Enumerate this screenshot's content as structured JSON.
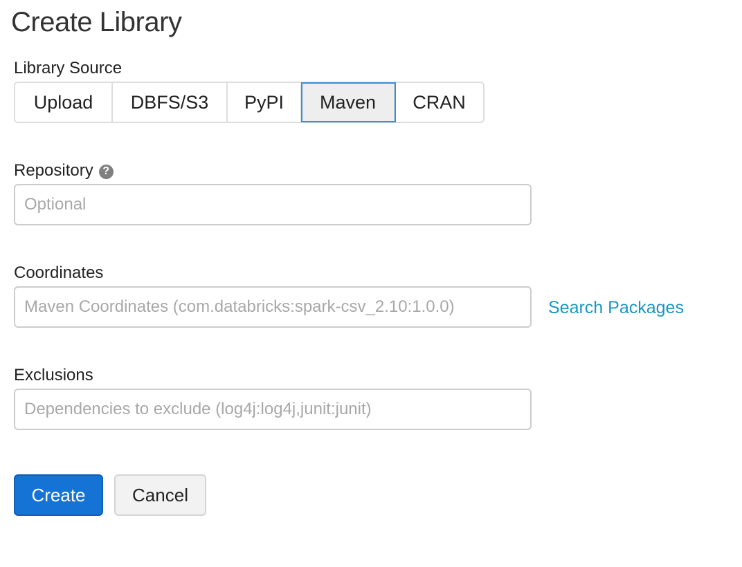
{
  "title": "Create Library",
  "library_source": {
    "label": "Library Source",
    "options": [
      "Upload",
      "DBFS/S3",
      "PyPI",
      "Maven",
      "CRAN"
    ],
    "selected": "Maven"
  },
  "repository": {
    "label": "Repository",
    "help_icon": "question-circle-icon",
    "placeholder": "Optional",
    "value": ""
  },
  "coordinates": {
    "label": "Coordinates",
    "placeholder": "Maven Coordinates (com.databricks:spark-csv_2.10:1.0.0)",
    "value": "",
    "search_link": "Search Packages"
  },
  "exclusions": {
    "label": "Exclusions",
    "placeholder": "Dependencies to exclude (log4j:log4j,junit:junit)",
    "value": ""
  },
  "actions": {
    "create": "Create",
    "cancel": "Cancel"
  },
  "colors": {
    "primary": "#1673d6",
    "link": "#1a97c2",
    "selected_border": "#3d8ddb"
  }
}
